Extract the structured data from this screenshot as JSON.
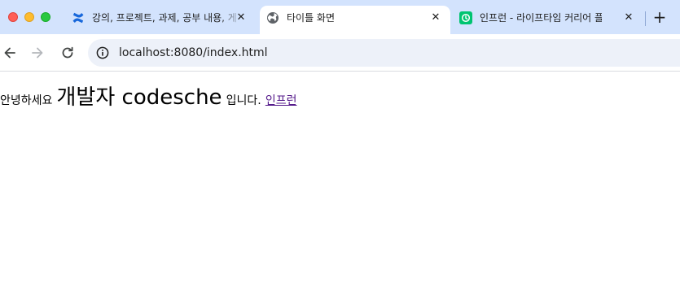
{
  "browser": {
    "tabs": [
      {
        "title": "강의, 프로젝트, 과제, 공부 내용, 게",
        "close": "✕"
      },
      {
        "title": "타이틀 화면",
        "close": "✕"
      },
      {
        "title": "인프런 - 라이프타임 커리어 플랫폼",
        "close": "✕"
      }
    ],
    "new_tab_label": "+",
    "address_bar": {
      "url": "localhost:8080/index.html"
    }
  },
  "page": {
    "greeting": "안녕하세요",
    "developer": "개발자 codesche",
    "suffix": "입니다.",
    "link_text": "인프런"
  },
  "colors": {
    "tab_strip": "#d3e3fd",
    "omnibox": "#edf1f9",
    "visited_link": "#551a8b"
  }
}
